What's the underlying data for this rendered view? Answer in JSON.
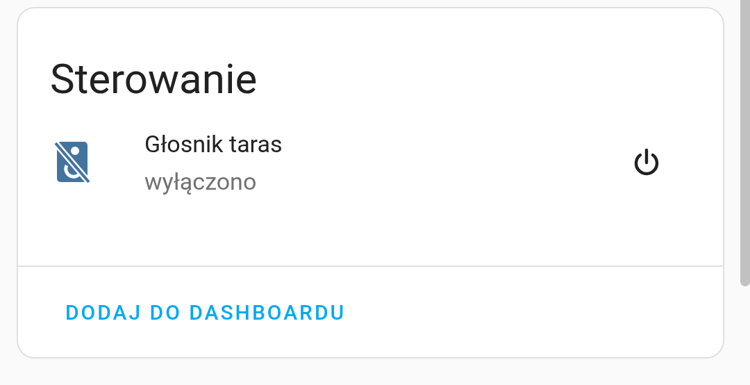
{
  "card": {
    "title": "Sterowanie",
    "entities": [
      {
        "name": "Głosnik taras",
        "state": "wyłączono",
        "on": false
      }
    ],
    "action": "DODAJ DO DASHBOARDU"
  }
}
